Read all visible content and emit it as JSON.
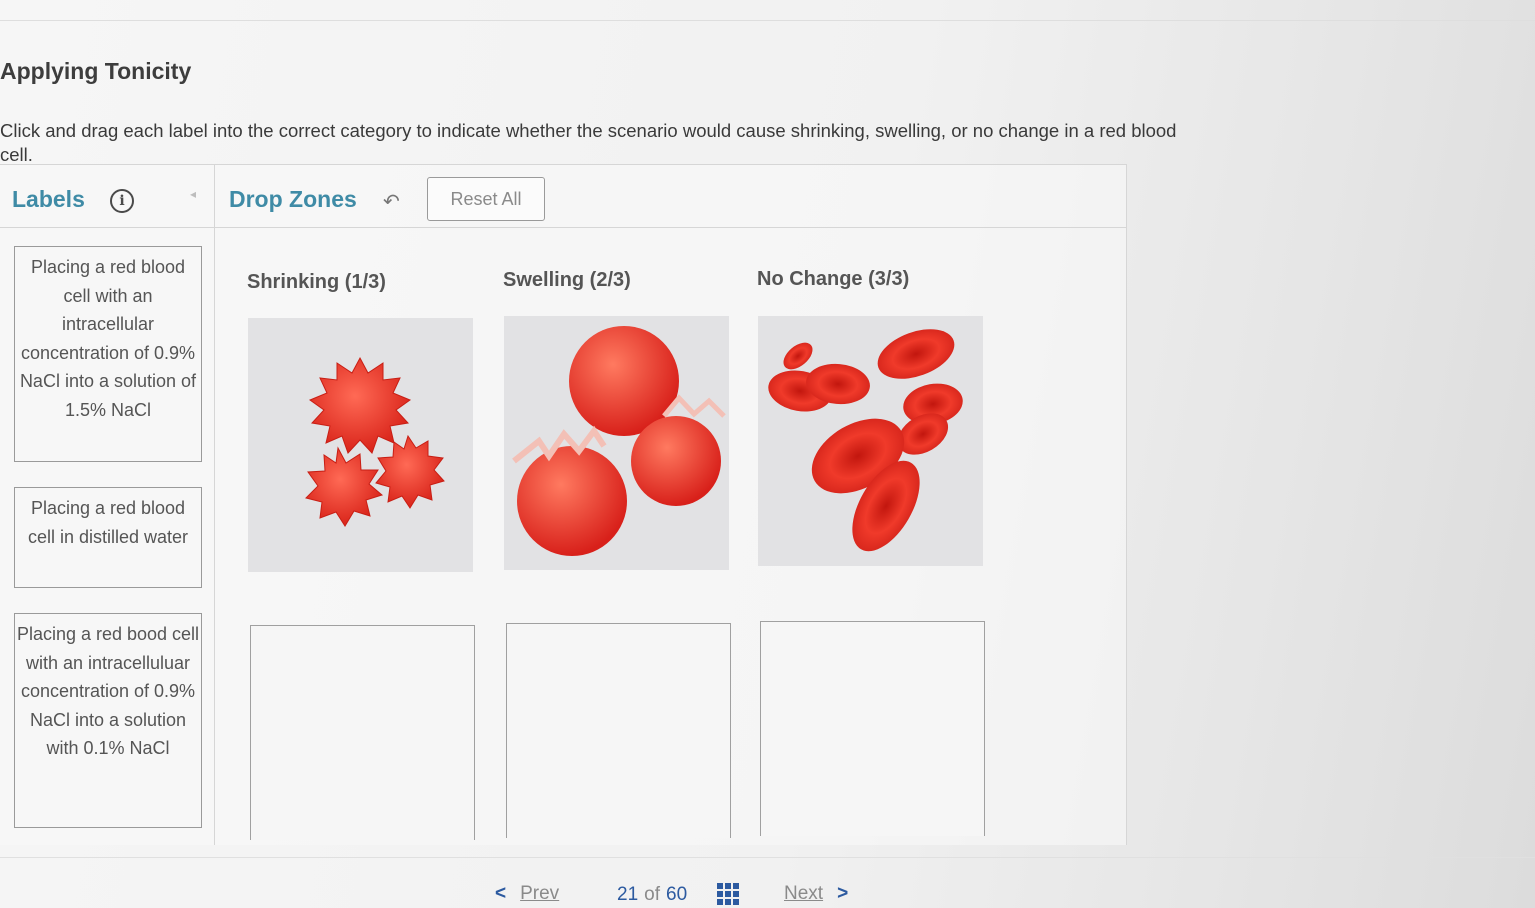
{
  "page": {
    "title": "Applying Tonicity",
    "instructions": "Click and drag each label into the correct category to indicate whether the scenario would cause shrinking, swelling, or no change in a red blood cell."
  },
  "labels_panel": {
    "title": "Labels",
    "info_icon": "info-icon",
    "items": [
      "Placing a red blood cell with an intracellular concentration of 0.9% NaCl into a solution of 1.5% NaCl",
      "Placing a red blood cell in distilled water",
      "Placing a red bood cell with an intracelluluar concentration of 0.9% NaCl into a solution with 0.1% NaCl"
    ]
  },
  "drop_panel": {
    "title": "Drop Zones",
    "undo_icon": "undo-icon",
    "reset_label": "Reset All",
    "zones": [
      {
        "title": "Shrinking (1/3)",
        "image": "crenated-red-blood-cells"
      },
      {
        "title": "Swelling (2/3)",
        "image": "swollen-lysed-red-blood-cells"
      },
      {
        "title": "No Change (3/3)",
        "image": "normal-red-blood-cells"
      }
    ]
  },
  "footer": {
    "prev_label": "Prev",
    "current_page": "21",
    "of_label": "of",
    "total_pages": "60",
    "next_label": "Next"
  },
  "colors": {
    "accent": "#3f8ba6",
    "nav": "#2c5aa0",
    "cell_red": "#e8261c"
  }
}
